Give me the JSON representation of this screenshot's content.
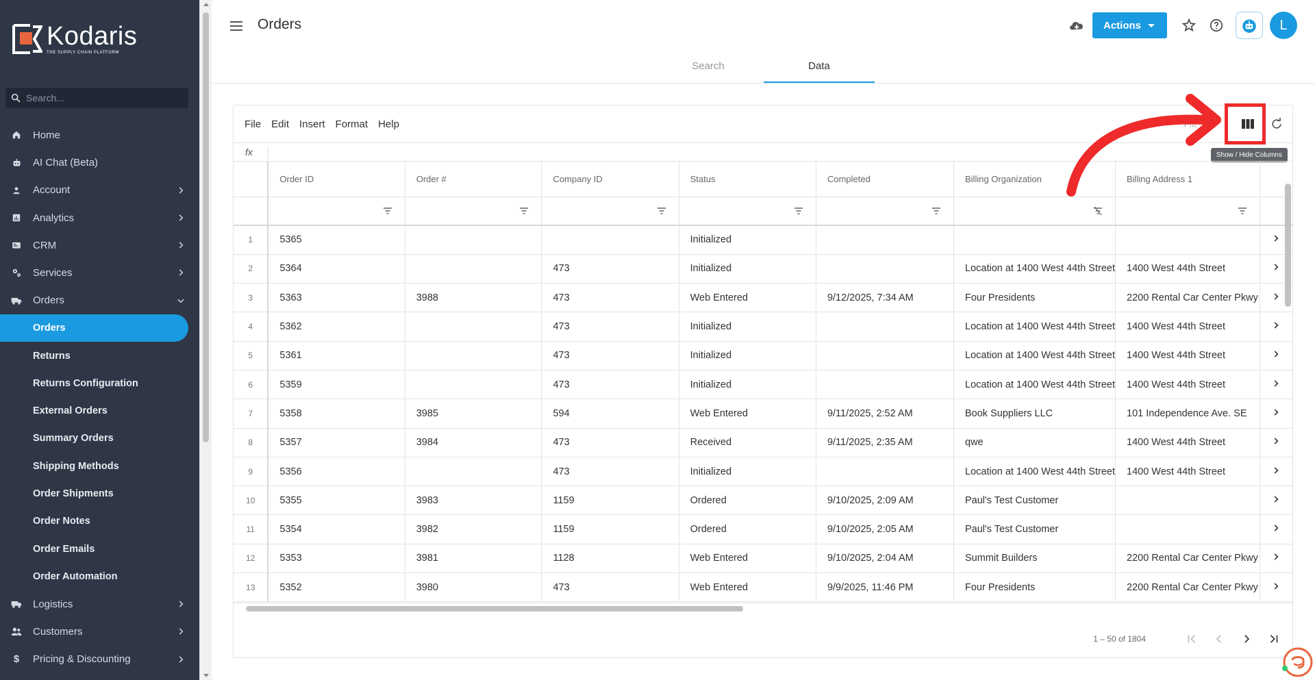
{
  "brand": {
    "name": "Kodaris",
    "tagline": "THE SUPPLY CHAIN PLATFORM"
  },
  "sidebar": {
    "search_placeholder": "Search...",
    "items": [
      {
        "label": "Home",
        "icon": "home-icon",
        "chevron": false
      },
      {
        "label": "AI Chat (Beta)",
        "icon": "robot-icon",
        "chevron": false
      },
      {
        "label": "Account",
        "icon": "account-icon",
        "chevron": true
      },
      {
        "label": "Analytics",
        "icon": "analytics-icon",
        "chevron": true
      },
      {
        "label": "CRM",
        "icon": "crm-icon",
        "chevron": true
      },
      {
        "label": "Services",
        "icon": "services-icon",
        "chevron": true
      },
      {
        "label": "Orders",
        "icon": "truck-icon",
        "chevron": "open"
      }
    ],
    "sub_items": [
      {
        "label": "Orders",
        "active": true
      },
      {
        "label": "Returns"
      },
      {
        "label": "Returns Configuration"
      },
      {
        "label": "External Orders"
      },
      {
        "label": "Summary Orders"
      },
      {
        "label": "Shipping Methods"
      },
      {
        "label": "Order Shipments"
      },
      {
        "label": "Order Notes"
      },
      {
        "label": "Order Emails"
      },
      {
        "label": "Order Automation"
      }
    ],
    "bottom_items": [
      {
        "label": "Logistics",
        "icon": "logistics-icon"
      },
      {
        "label": "Customers",
        "icon": "customers-icon"
      },
      {
        "label": "Pricing & Discounting",
        "icon": "dollar-icon"
      }
    ]
  },
  "header": {
    "title": "Orders",
    "actions_label": "Actions",
    "avatar_letter": "L",
    "tabs": [
      {
        "label": "Search",
        "active": false
      },
      {
        "label": "Data",
        "active": true
      }
    ]
  },
  "grid": {
    "menu": [
      "File",
      "Edit",
      "Insert",
      "Format",
      "Help"
    ],
    "fx_label": "fx",
    "filter_label": "Filt",
    "tooltip": "Show / Hide Columns",
    "columns": [
      "Order ID",
      "Order #",
      "Company ID",
      "Status",
      "Completed",
      "Billing Organization",
      "Billing Address 1"
    ],
    "rows": [
      [
        "1",
        "5365",
        "",
        "",
        "Initialized",
        "",
        "",
        ""
      ],
      [
        "2",
        "5364",
        "",
        "473",
        "Initialized",
        "",
        "Location at 1400 West 44th Street",
        "1400 West 44th Street"
      ],
      [
        "3",
        "5363",
        "3988",
        "473",
        "Web Entered",
        "9/12/2025, 7:34 AM",
        "Four Presidents",
        "2200 Rental Car Center Pkwy"
      ],
      [
        "4",
        "5362",
        "",
        "473",
        "Initialized",
        "",
        "Location at 1400 West 44th Street",
        "1400 West 44th Street"
      ],
      [
        "5",
        "5361",
        "",
        "473",
        "Initialized",
        "",
        "Location at 1400 West 44th Street",
        "1400 West 44th Street"
      ],
      [
        "6",
        "5359",
        "",
        "473",
        "Initialized",
        "",
        "Location at 1400 West 44th Street",
        "1400 West 44th Street"
      ],
      [
        "7",
        "5358",
        "3985",
        "594",
        "Web Entered",
        "9/11/2025, 2:52 AM",
        "Book Suppliers LLC",
        "101 Independence Ave. SE"
      ],
      [
        "8",
        "5357",
        "3984",
        "473",
        "Received",
        "9/11/2025, 2:35 AM",
        "qwe",
        "1400 West 44th Street"
      ],
      [
        "9",
        "5356",
        "",
        "473",
        "Initialized",
        "",
        "Location at 1400 West 44th Street",
        "1400 West 44th Street"
      ],
      [
        "10",
        "5355",
        "3983",
        "1159",
        "Ordered",
        "9/10/2025, 2:09 AM",
        "Paul's Test Customer",
        ""
      ],
      [
        "11",
        "5354",
        "3982",
        "1159",
        "Ordered",
        "9/10/2025, 2:05 AM",
        "Paul's Test Customer",
        ""
      ],
      [
        "12",
        "5353",
        "3981",
        "1128",
        "Web Entered",
        "9/10/2025, 2:04 AM",
        "Summit Builders",
        "2200 Rental Car Center Pkwy"
      ],
      [
        "13",
        "5352",
        "3980",
        "473",
        "Web Entered",
        "9/9/2025, 11:46 PM",
        "Four Presidents",
        "2200 Rental Car Center Pkwy"
      ]
    ],
    "pagination": {
      "range": "1 – 50 of 1804"
    }
  },
  "colors": {
    "accent": "#1a9ae0",
    "sidebar": "#2f3747",
    "annotation": "#ef2a2a"
  }
}
